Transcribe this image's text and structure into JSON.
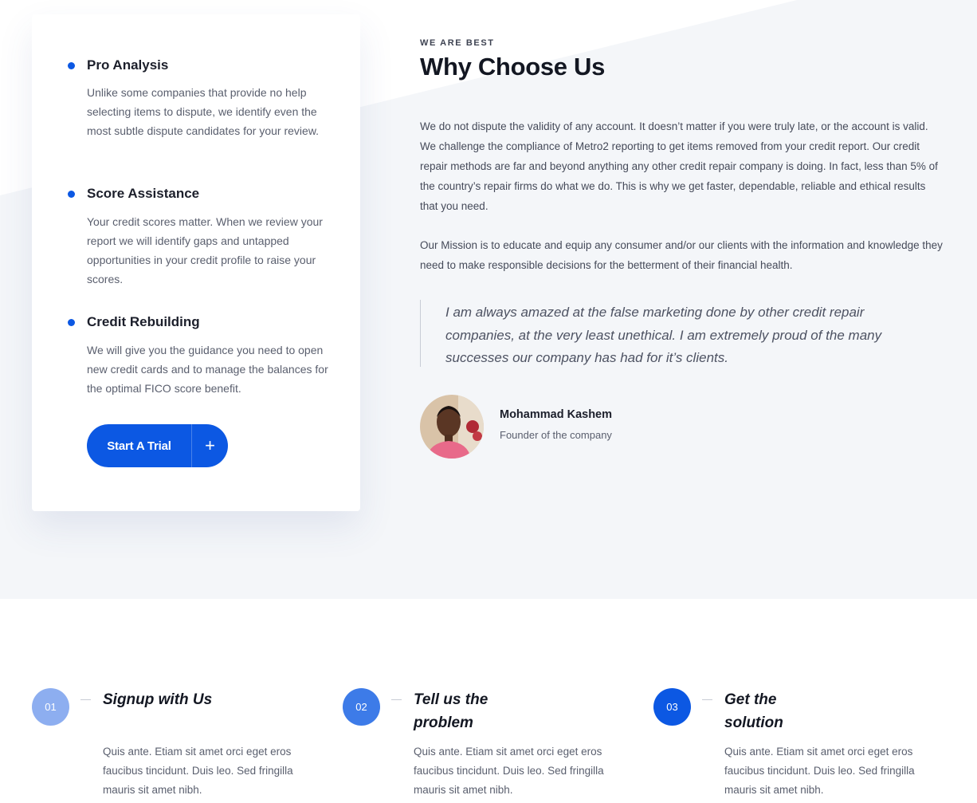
{
  "features": [
    {
      "title": "Pro Analysis",
      "text": "Unlike some companies that provide no help selecting items to dispute, we identify even the most subtle dispute candidates for your review."
    },
    {
      "title": "Score Assistance",
      "text": "Your credit scores matter. When we review your report we will identify gaps and untapped opportunities in your credit profile to raise your scores."
    },
    {
      "title": "Credit Rebuilding",
      "text": "We will give you the guidance you need to open new credit cards and to manage the balances for the optimal FICO score benefit."
    }
  ],
  "cta": {
    "label": "Start A Trial",
    "icon": "+"
  },
  "about": {
    "eyebrow": "WE ARE BEST",
    "title": "Why Choose Us",
    "paragraph1": "We do not dispute the validity of any account. It doesn’t matter if you were truly late, or the account is valid. We challenge the compliance of Metro2 reporting to get items removed from your credit report. Our credit repair methods are far and beyond anything any other credit repair company is doing. In fact, less than 5% of the country’s repair firms do what we do. This is why we get faster, dependable, reliable and ethical results that you need.",
    "paragraph2": "Our Mission is to educate and equip any consumer and/or our clients with the information and knowledge they need to make responsible decisions for the betterment of their financial health.",
    "quote": "I am always amazed at the false marketing done by other credit repair companies, at the very least unethical. I am extremely proud of the many successes our company has had for it’s clients.",
    "author_name": "Mohammad Kashem",
    "author_role": "Founder of the company"
  },
  "steps": [
    {
      "number": "01",
      "title": "Signup with Us",
      "text": "Quis ante. Etiam sit amet orci eget eros faucibus tincidunt. Duis leo. Sed fringilla mauris sit amet nibh.",
      "color": "#8daef0"
    },
    {
      "number": "02",
      "title": "Tell us the problem",
      "text": "Quis ante. Etiam sit amet orci eget eros faucibus tincidunt. Duis leo. Sed fringilla mauris sit amet nibh.",
      "color": "#3d7be8"
    },
    {
      "number": "03",
      "title": "Get the solution",
      "text": "Quis ante. Etiam sit amet orci eget eros faucibus tincidunt. Duis leo. Sed fringilla mauris sit amet nibh.",
      "color": "#0c58e3"
    }
  ],
  "colors": {
    "accent": "#0c58e3",
    "section_bg": "#f4f6f9"
  }
}
